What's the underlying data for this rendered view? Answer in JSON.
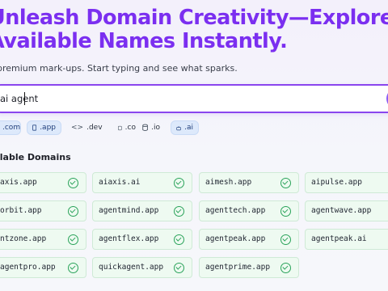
{
  "hero": {
    "headline_line1": "Unleash Domain Creativity—Explore",
    "headline_line2": "Available Names Instantly.",
    "subtitle": "premium mark-ups. Start typing and see what sparks."
  },
  "search": {
    "value": "ai agent",
    "button_icon": "search-icon"
  },
  "tlds": [
    {
      "label": ".com",
      "icon": "globe-icon",
      "selected": true
    },
    {
      "label": ".app",
      "icon": "phone-icon",
      "selected": true
    },
    {
      "label": ".dev",
      "icon": "code-icon",
      "selected": false
    },
    {
      "label": ".co",
      "icon": "document-icon",
      "selected": false
    },
    {
      "label": ".io",
      "icon": "database-icon",
      "selected": false
    },
    {
      "label": ".ai",
      "icon": "robot-icon",
      "selected": true
    }
  ],
  "results": {
    "title": "ilable Domains",
    "domains": [
      {
        "name": "axis.app",
        "status_icon": "check-circle-icon"
      },
      {
        "name": "aiaxis.ai",
        "status_icon": "check-circle-icon"
      },
      {
        "name": "aimesh.app",
        "status_icon": "check-circle-icon"
      },
      {
        "name": "aipulse.app",
        "status_icon": "check-circle-icon"
      },
      {
        "name": "orbit.app",
        "status_icon": "check-circle-icon"
      },
      {
        "name": "agentmind.app",
        "status_icon": "check-circle-icon"
      },
      {
        "name": "agenttech.app",
        "status_icon": "check-circle-icon"
      },
      {
        "name": "agentwave.app",
        "status_icon": "check-circle-icon"
      },
      {
        "name": "ntzone.app",
        "status_icon": "check-circle-icon"
      },
      {
        "name": "agentflex.app",
        "status_icon": "check-circle-icon"
      },
      {
        "name": "agentpeak.app",
        "status_icon": "check-circle-icon"
      },
      {
        "name": "agentpeak.ai",
        "status_icon": "check-circle-icon"
      },
      {
        "name": "agentpro.app",
        "status_icon": "check-circle-icon"
      },
      {
        "name": "quickagent.app",
        "status_icon": "check-circle-icon"
      },
      {
        "name": "agentprime.app",
        "status_icon": "check-circle-icon"
      }
    ]
  },
  "colors": {
    "accent": "#7b2ff0",
    "available_bg": "#eefaf1",
    "available_check": "#2aa35a",
    "selected_chip_bg": "#dde9fb"
  }
}
